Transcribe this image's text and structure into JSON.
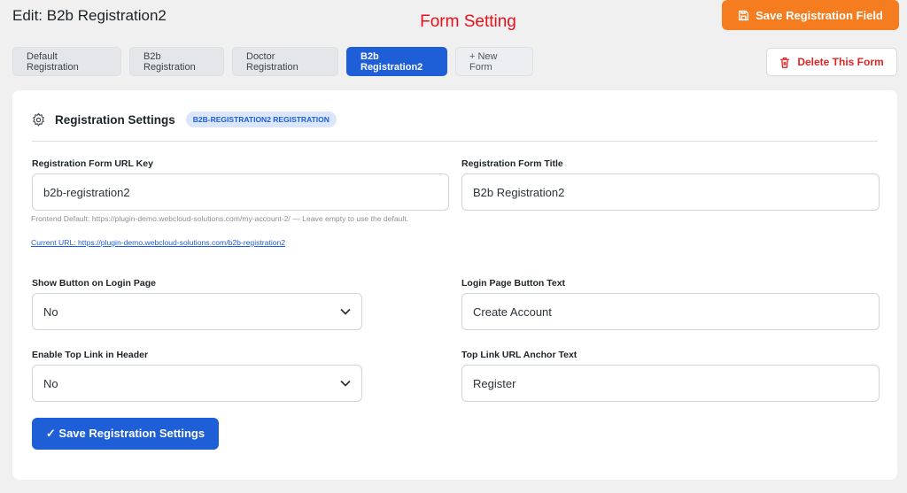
{
  "header": {
    "edit_title": "Edit: B2b Registration2",
    "center_title": "Form Setting",
    "save_field_label": "Save Registration Field",
    "delete_label": "Delete This Form"
  },
  "tabs": [
    {
      "label": "Default Registration",
      "active": false
    },
    {
      "label": "B2b Registration",
      "active": false
    },
    {
      "label": "Doctor Registration",
      "active": false
    },
    {
      "label": "B2b Registration2",
      "active": true
    },
    {
      "label": "+ New Form",
      "active": false
    }
  ],
  "settings": {
    "title": "Registration Settings",
    "badge": "B2B-REGISTRATION2 REGISTRATION",
    "url_key_label": "Registration Form URL Key",
    "url_key_value": "b2b-registration2",
    "form_title_label": "Registration Form Title",
    "form_title_value": "B2b Registration2",
    "help_text": "Frontend Default: https://plugin-demo.webcloud-solutions.com/my-account-2/ — Leave empty to use the default.",
    "current_url": "Current URL: https://plugin-demo.webcloud-solutions.com/b2b-registration2",
    "show_button_label": "Show Button on Login Page",
    "show_button_value": "No",
    "login_button_text_label": "Login Page Button Text",
    "login_button_text_value": "Create Account",
    "top_link_label": "Enable Top Link in Header",
    "top_link_value": "No",
    "anchor_text_label": "Top Link URL Anchor Text",
    "anchor_text_value": "Register",
    "save_settings_label": "✓ Save Registration Settings"
  },
  "colors": {
    "accent_orange": "#f57c1f",
    "accent_blue": "#1e5fd7",
    "danger_red": "#dc2626"
  },
  "icons": {
    "save_field": "save-icon",
    "delete": "trash-icon",
    "settings": "gear-icon",
    "select": "chevron-down-icon"
  }
}
